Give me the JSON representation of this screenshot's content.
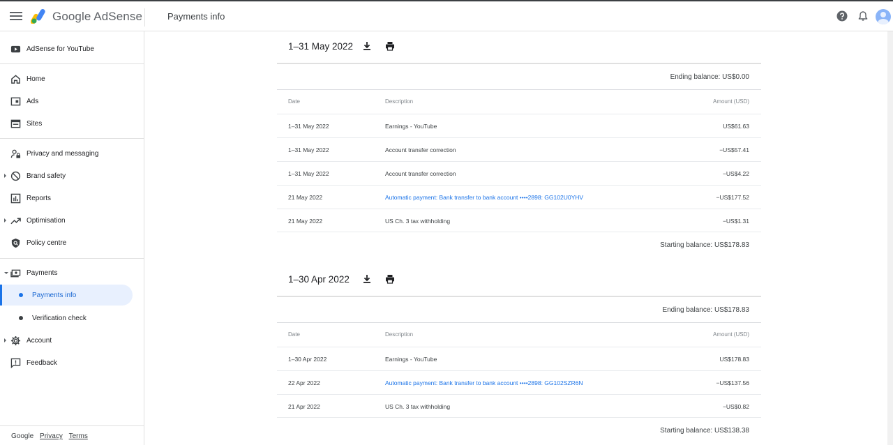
{
  "header": {
    "brand": "Google AdSense",
    "page_title": "Payments info"
  },
  "sidebar": {
    "items": [
      {
        "label": "AdSense for YouTube",
        "icon": "youtube-icon"
      },
      {
        "label": "Home",
        "icon": "home-icon"
      },
      {
        "label": "Ads",
        "icon": "ads-icon"
      },
      {
        "label": "Sites",
        "icon": "sites-icon"
      },
      {
        "label": "Privacy and messaging",
        "icon": "privacy-icon"
      },
      {
        "label": "Brand safety",
        "icon": "block-icon"
      },
      {
        "label": "Reports",
        "icon": "bar-chart-icon"
      },
      {
        "label": "Optimisation",
        "icon": "trending-up-icon"
      },
      {
        "label": "Policy centre",
        "icon": "policy-icon"
      },
      {
        "label": "Payments",
        "icon": "payments-icon"
      },
      {
        "label": "Payments info",
        "icon": "dot-icon"
      },
      {
        "label": "Verification check",
        "icon": "dot-icon"
      },
      {
        "label": "Account",
        "icon": "gear-icon"
      },
      {
        "label": "Feedback",
        "icon": "feedback-icon"
      }
    ],
    "footer": {
      "google": "Google",
      "privacy": "Privacy",
      "terms": "Terms"
    }
  },
  "columns": {
    "date": "Date",
    "description": "Description",
    "amount": "Amount (USD)"
  },
  "statements": [
    {
      "title": "1–31 May 2022",
      "ending_balance": "Ending balance: US$0.00",
      "starting_balance": "Starting balance: US$178.83",
      "rows": [
        {
          "date": "1–31 May 2022",
          "description": "Earnings - YouTube",
          "amount": "US$61.63"
        },
        {
          "date": "1–31 May 2022",
          "description": "Account transfer correction",
          "amount": "−US$57.41"
        },
        {
          "date": "1–31 May 2022",
          "description": "Account transfer correction",
          "amount": "−US$4.22"
        },
        {
          "date": "21 May 2022",
          "description": "Automatic payment: Bank transfer to bank account  ••••2898: GG102U0YHV",
          "amount": "−US$177.52"
        },
        {
          "date": "21 May 2022",
          "description": "US Ch. 3 tax withholding",
          "amount": "−US$1.31"
        }
      ]
    },
    {
      "title": "1–30 Apr 2022",
      "ending_balance": "Ending balance: US$178.83",
      "starting_balance": "Starting balance: US$138.38",
      "rows": [
        {
          "date": "1–30 Apr 2022",
          "description": "Earnings - YouTube",
          "amount": "US$178.83"
        },
        {
          "date": "22 Apr 2022",
          "description": "Automatic payment: Bank transfer to bank account  ••••2898: GG102SZR6N",
          "amount": "−US$137.56"
        },
        {
          "date": "21 Apr 2022",
          "description": "US Ch. 3 tax withholding",
          "amount": "−US$0.82"
        }
      ]
    }
  ],
  "colors": {
    "accent": "#1a73e8",
    "active_bg": "#e8f0fe",
    "text": "#202124",
    "muted": "#80868b"
  }
}
